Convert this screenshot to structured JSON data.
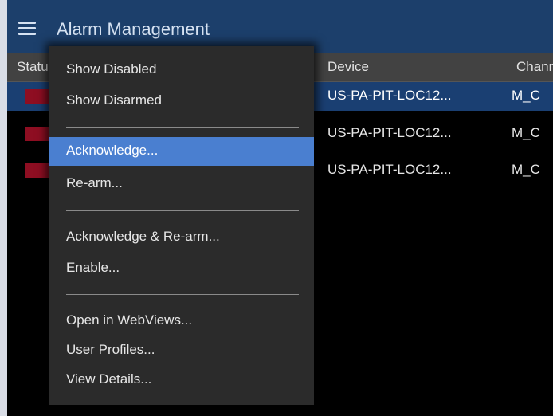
{
  "header": {
    "title": "Alarm Management",
    "menu_icon": "hamburger-icon"
  },
  "columns": {
    "status": "Status",
    "device": "Device",
    "channel": "Channel"
  },
  "rows": [
    {
      "status_color": "#8e0e22",
      "device": "US-PA-PIT-LOC12...",
      "channel": "M_C",
      "selected": true
    },
    {
      "status_color": "#8e0e22",
      "device": "US-PA-PIT-LOC12...",
      "channel": "M_C",
      "selected": false
    },
    {
      "status_color": "#8e0e22",
      "device": "US-PA-PIT-LOC12...",
      "channel": "M_C",
      "selected": false
    }
  ],
  "context_menu": {
    "highlighted_item": "Acknowledge...",
    "items": [
      "Show Disabled",
      "Show Disarmed",
      "Acknowledge...",
      "Re-arm...",
      "Acknowledge & Re-arm...",
      "Enable...",
      "Open in WebViews...",
      "User Profiles...",
      "View Details..."
    ]
  },
  "colors": {
    "title_bar": "#1c3f6b",
    "selected_row": "#1a3f72",
    "menu_highlight": "#4a7fd0",
    "alarm_red": "#8e0e22"
  }
}
